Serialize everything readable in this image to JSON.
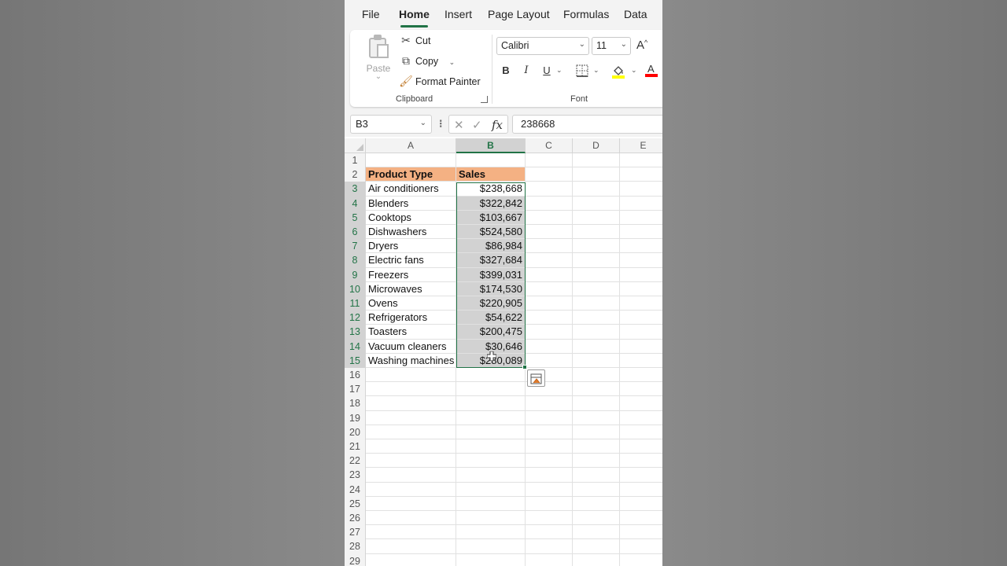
{
  "menu": {
    "tabs": [
      {
        "label": "File"
      },
      {
        "label": "Home",
        "active": true
      },
      {
        "label": "Insert"
      },
      {
        "label": "Page Layout"
      },
      {
        "label": "Formulas"
      },
      {
        "label": "Data"
      }
    ]
  },
  "clipboard": {
    "paste_label": "Paste",
    "paste_caret": "⌄",
    "cut_label": "Cut",
    "copy_label": "Copy",
    "format_painter_label": "Format Painter",
    "group_label": "Clipboard"
  },
  "font": {
    "family": "Calibri",
    "size": "11",
    "grow_icon": "A^",
    "bold": "B",
    "italic": "I",
    "underline": "U",
    "group_label": "Font",
    "highlight_color": "#ffff00",
    "font_color": "#ff0000"
  },
  "formula_bar": {
    "name_box": "B3",
    "value": "238668"
  },
  "columns": [
    "A",
    "B",
    "C",
    "D",
    "E"
  ],
  "selected_column": "B",
  "rows": [
    {
      "n": "1",
      "a": "",
      "b": ""
    },
    {
      "n": "2",
      "a": "Product Type",
      "b": "Sales"
    },
    {
      "n": "3",
      "a": "Air conditioners",
      "b": "$238,668"
    },
    {
      "n": "4",
      "a": "Blenders",
      "b": "$322,842"
    },
    {
      "n": "5",
      "a": "Cooktops",
      "b": "$103,667"
    },
    {
      "n": "6",
      "a": "Dishwashers",
      "b": "$524,580"
    },
    {
      "n": "7",
      "a": "Dryers",
      "b": "$86,984"
    },
    {
      "n": "8",
      "a": "Electric fans",
      "b": "$327,684"
    },
    {
      "n": "9",
      "a": "Freezers",
      "b": "$399,031"
    },
    {
      "n": "10",
      "a": "Microwaves",
      "b": "$174,530"
    },
    {
      "n": "11",
      "a": "Ovens",
      "b": "$220,905"
    },
    {
      "n": "12",
      "a": "Refrigerators",
      "b": "$54,622"
    },
    {
      "n": "13",
      "a": "Toasters",
      "b": "$200,475"
    },
    {
      "n": "14",
      "a": "Vacuum cleaners",
      "b": "$30,646"
    },
    {
      "n": "15",
      "a": "Washing machines",
      "b": "$280,089"
    },
    {
      "n": "16",
      "a": "",
      "b": ""
    },
    {
      "n": "17",
      "a": "",
      "b": ""
    },
    {
      "n": "18",
      "a": "",
      "b": ""
    },
    {
      "n": "19",
      "a": "",
      "b": ""
    },
    {
      "n": "20",
      "a": "",
      "b": ""
    },
    {
      "n": "21",
      "a": "",
      "b": ""
    },
    {
      "n": "22",
      "a": "",
      "b": ""
    },
    {
      "n": "23",
      "a": "",
      "b": ""
    },
    {
      "n": "24",
      "a": "",
      "b": ""
    },
    {
      "n": "25",
      "a": "",
      "b": ""
    },
    {
      "n": "26",
      "a": "",
      "b": ""
    },
    {
      "n": "27",
      "a": "",
      "b": ""
    },
    {
      "n": "28",
      "a": "",
      "b": ""
    },
    {
      "n": "29",
      "a": "",
      "b": ""
    }
  ],
  "colors": {
    "accent": "#217346",
    "header_fill": "#f4b183",
    "selection_fill": "#d2d2d2"
  }
}
